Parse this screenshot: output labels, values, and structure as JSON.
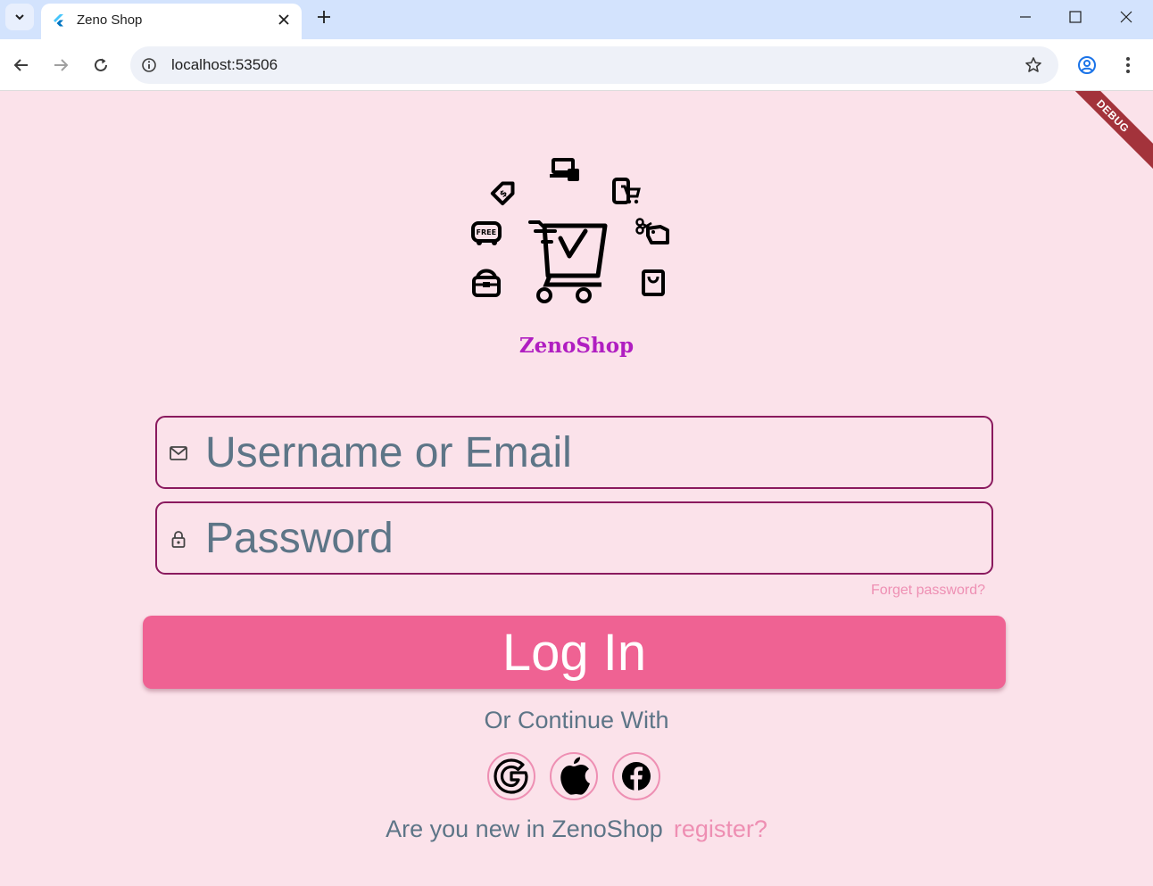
{
  "browser": {
    "tab_title": "Zeno Shop",
    "url": "localhost:53506"
  },
  "app": {
    "debug_label": "DEBUG",
    "brand_name": "ZenoShop",
    "username_placeholder": "Username or Email",
    "password_placeholder": "Password",
    "forgot_password": "Forget password?",
    "login_label": "Log In",
    "continue_with": "Or Continue With",
    "new_user_text": "Are you new in ZenoShop",
    "register_label": "register?",
    "social_buttons": [
      "google",
      "apple",
      "facebook"
    ]
  },
  "colors": {
    "background": "#fbe2ea",
    "accent": "#ef6293",
    "field_border": "#8a1a5e",
    "brand_text": "#b01ec1",
    "link": "#ee8fb3",
    "muted_text": "#5d7587"
  }
}
